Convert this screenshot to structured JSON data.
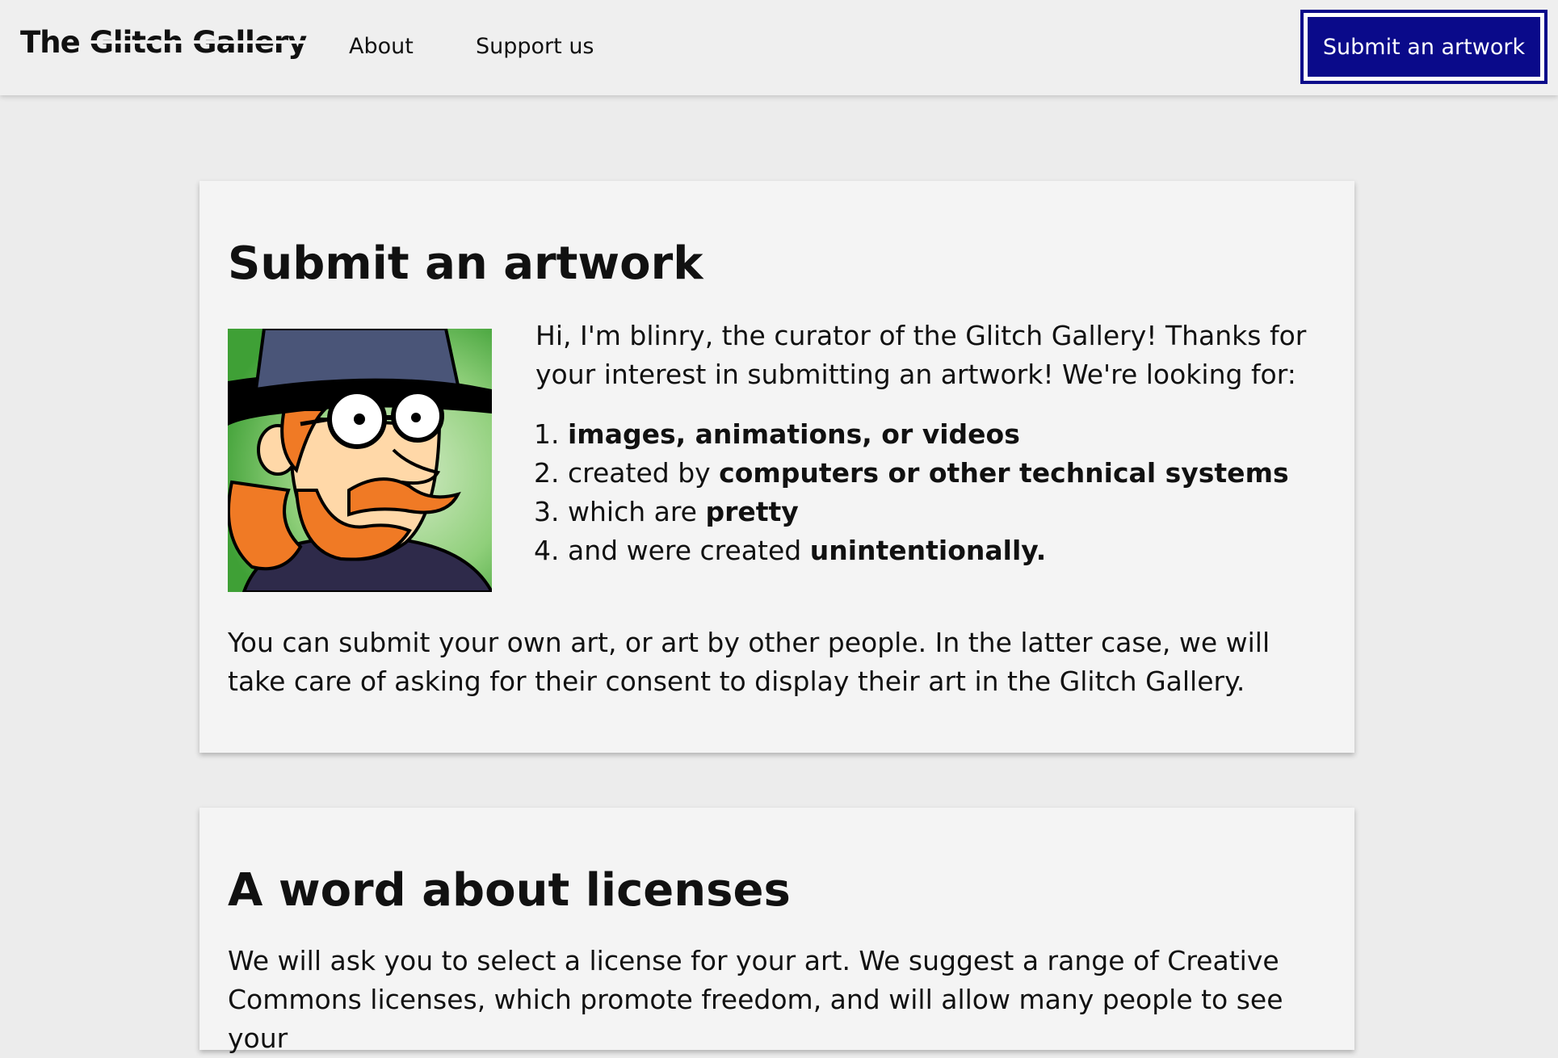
{
  "header": {
    "logo_prefix": "The ",
    "logo_glitch": "Glitch Gallery",
    "nav": [
      {
        "label": "About"
      },
      {
        "label": "Support us"
      }
    ],
    "cta_label": "Submit an artwork"
  },
  "submit_section": {
    "title": "Submit an artwork",
    "avatar_alt": "blinry avatar",
    "intro": "Hi, I'm blinry, the curator of the Glitch Gallery! Thanks for your interest in submitting an artwork! We're looking for:",
    "criteria": [
      {
        "num": "1.",
        "pre": "",
        "bold": "images, animations, or videos",
        "post": ""
      },
      {
        "num": "2.",
        "pre": "created by ",
        "bold": "computers or other technical systems",
        "post": ""
      },
      {
        "num": "3.",
        "pre": "which are ",
        "bold": "pretty",
        "post": ""
      },
      {
        "num": "4.",
        "pre": "and were created ",
        "bold": "unintentionally.",
        "post": ""
      }
    ],
    "note": "You can submit your own art, or art by other people. In the latter case, we will take care of asking for their consent to display their art in the Glitch Gallery."
  },
  "licenses_section": {
    "title": "A word about licenses",
    "text": "We will ask you to select a license for your art. We suggest a range of Creative Commons licenses, which promote freedom, and will allow many people to see your"
  },
  "colors": {
    "accent": "#0a0a8a",
    "background": "#ececec",
    "card": "#f4f4f4"
  }
}
